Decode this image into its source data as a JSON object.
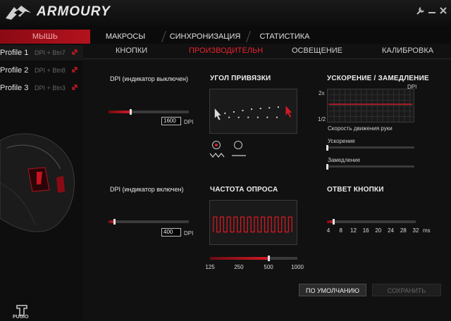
{
  "app": {
    "title": "ARMOURY"
  },
  "main_tabs": [
    {
      "label": "МЫШЬ"
    },
    {
      "label": "МАКРОСЫ"
    },
    {
      "label": "СИНХРОНИЗАЦИЯ"
    },
    {
      "label": "СТАТИСТИКА"
    }
  ],
  "sub_tabs": [
    {
      "label": "КНОПКИ"
    },
    {
      "label": "ПРОИЗВОДИТЕЛЬН"
    },
    {
      "label": "ОСВЕЩЕНИЕ"
    },
    {
      "label": "КАЛИБРОВКА"
    }
  ],
  "profiles": [
    {
      "name": "Profile 1",
      "binding": "DPI + Btn7"
    },
    {
      "name": "Profile 2",
      "binding": "DPI + Btn8"
    },
    {
      "name": "Profile 3",
      "binding": "DPI + Btn3"
    }
  ],
  "device": {
    "name": "PUGIO"
  },
  "dpi_off": {
    "label": "DPI (индикатор выключен)",
    "value": "1600",
    "unit": "DPI",
    "level": 0.27
  },
  "dpi_on": {
    "label": "DPI (индикатор включен)",
    "value": "400",
    "unit": "DPI",
    "level": 0.07
  },
  "angle_snapping": {
    "label": "УГОЛ ПРИВЯЗКИ",
    "selected": 0
  },
  "acceleration": {
    "label": "УСКОРЕНИЕ / ЗАМЕДЛЕНИЕ",
    "graph_axis": "DPI",
    "y_top": "2x",
    "y_bottom": "1/2",
    "hand_speed": "Скорость движения руки",
    "accel_label": "Ускорение",
    "decel_label": "Замедление",
    "accel_level": 0.0,
    "decel_level": 0.0
  },
  "polling": {
    "label": "ЧАСТОТА ОПРОСА",
    "ticks": [
      "125",
      "250",
      "500",
      "1000"
    ],
    "level": 0.67
  },
  "button_response": {
    "label": "ОТВЕТ КНОПКИ",
    "ticks": [
      "4",
      "8",
      "12",
      "16",
      "20",
      "24",
      "28",
      "32"
    ],
    "unit": "ms",
    "level": 0.07
  },
  "buttons": {
    "default": "ПО УМОЛЧАНИЮ",
    "save": "СОХРАНИТЬ"
  },
  "colors": {
    "accent": "#d41a25",
    "tab_active": "#b3121d",
    "bg": "#111111"
  }
}
